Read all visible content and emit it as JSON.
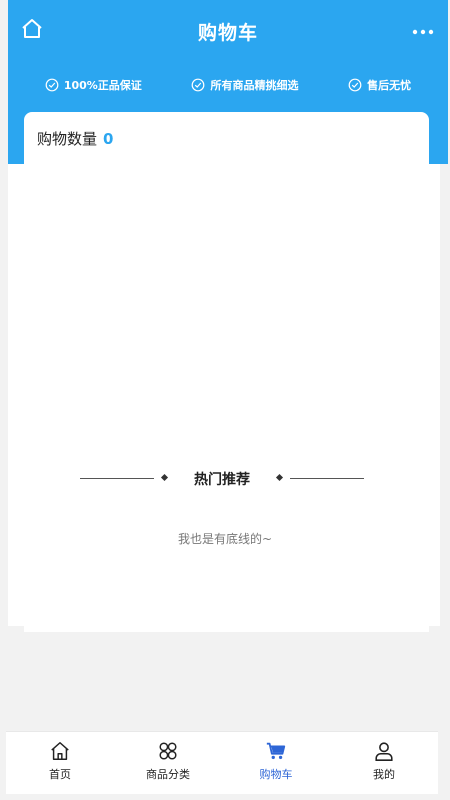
{
  "header": {
    "title": "购物车",
    "icons": {
      "home": "home-icon",
      "more": "more-dots-icon"
    },
    "features": [
      {
        "label": "100%正品保证",
        "icon": "check-circle-icon"
      },
      {
        "label": "所有商品精挑细选",
        "icon": "check-circle-icon"
      },
      {
        "label": "售后无忧",
        "icon": "check-circle-icon"
      }
    ]
  },
  "cart": {
    "count_label": "购物数量",
    "count_value": "0"
  },
  "recommend": {
    "title": "热门推荐",
    "bottom_text": "我也是有底线的~"
  },
  "tabbar": {
    "items": [
      {
        "label": "首页",
        "icon": "home-icon",
        "active": false
      },
      {
        "label": "商品分类",
        "icon": "category-icon",
        "active": false
      },
      {
        "label": "购物车",
        "icon": "cart-icon",
        "active": true
      },
      {
        "label": "我的",
        "icon": "user-icon",
        "active": false
      }
    ]
  },
  "colors": {
    "primary": "#2ba6f0",
    "active_tab": "#2e66d6",
    "page_bg": "#f2f2f2"
  }
}
